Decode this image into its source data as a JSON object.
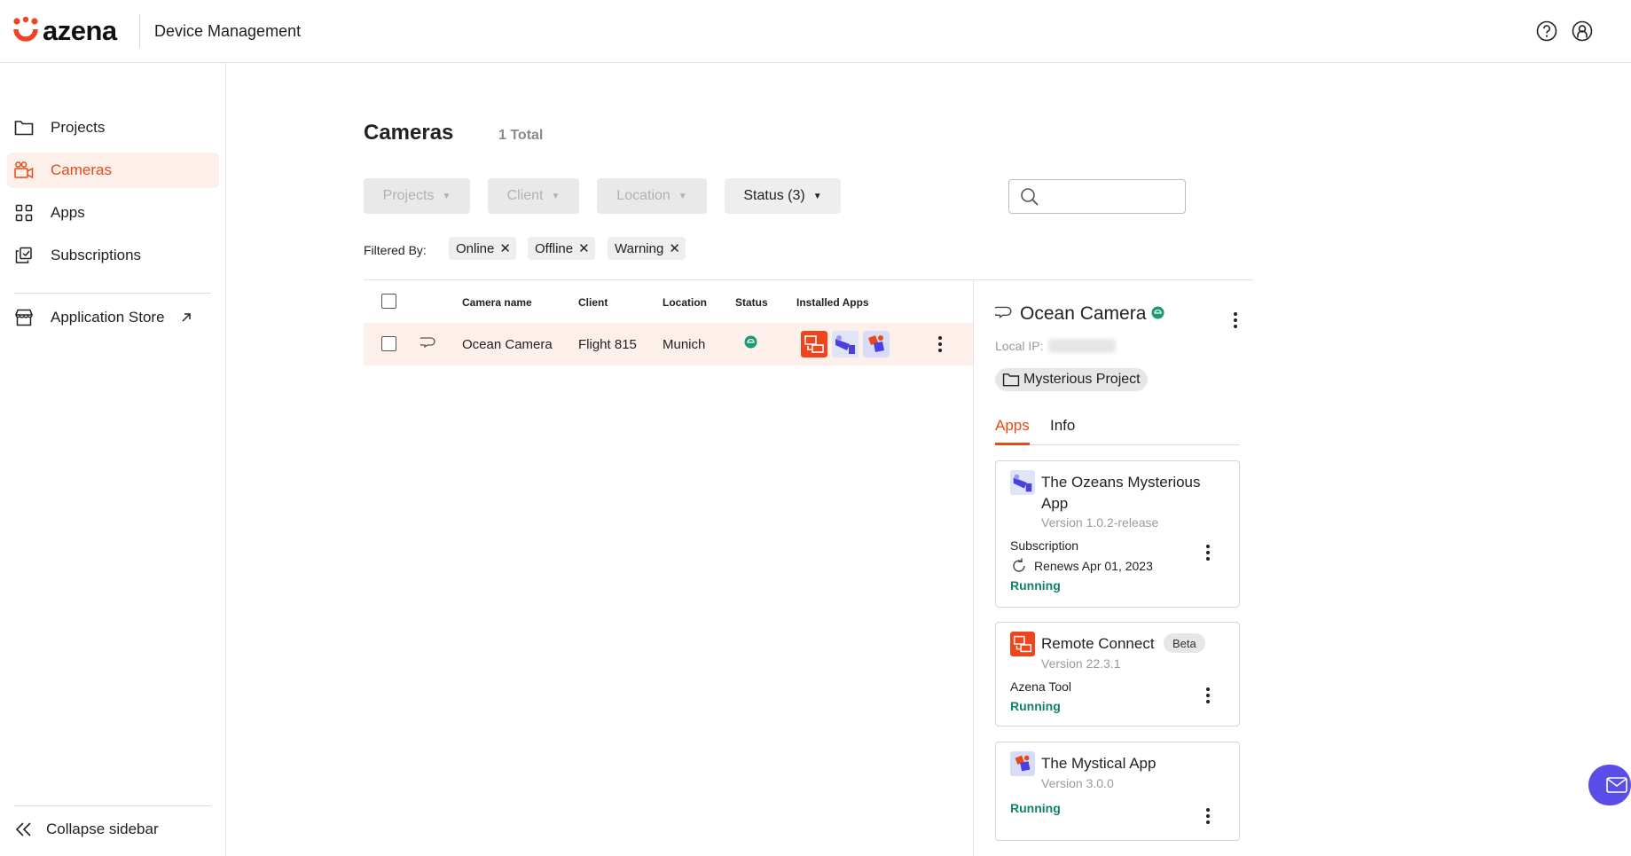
{
  "header": {
    "logo_text": "azena",
    "title": "Device Management",
    "help_icon": "help-icon",
    "account_icon": "user-icon",
    "brand_color": "#ef4423"
  },
  "sidebar": {
    "items": [
      {
        "label": "Projects",
        "icon": "folder-icon"
      },
      {
        "label": "Cameras",
        "icon": "camera-icon",
        "active": true
      },
      {
        "label": "Apps",
        "icon": "apps-grid-icon"
      },
      {
        "label": "Subscriptions",
        "icon": "subscriptions-icon"
      }
    ],
    "store": {
      "label": "Application Store",
      "icon": "store-icon",
      "external_icon": "arrow-up-right-icon"
    },
    "collapse_label": "Collapse sidebar"
  },
  "main": {
    "title": "Cameras",
    "total": "1 Total",
    "filters": {
      "projects": "Projects",
      "client": "Client",
      "location": "Location",
      "status": "Status (3)"
    },
    "search": {
      "placeholder": "",
      "value": ""
    },
    "filtered_by_label": "Filtered By:",
    "chips": [
      "Online",
      "Offline",
      "Warning"
    ],
    "table": {
      "columns": [
        "Camera name",
        "Client",
        "Location",
        "Status",
        "Installed Apps"
      ],
      "rows": [
        {
          "name": "Ocean Camera",
          "client": "Flight 815",
          "location": "Munich",
          "status": "online",
          "apps": [
            "remote-connect-icon",
            "ozeans-app-icon",
            "mystical-app-icon"
          ]
        }
      ]
    }
  },
  "detail": {
    "camera_name": "Ocean Camera",
    "status": "online",
    "local_ip_label": "Local IP:",
    "project": "Mysterious Project",
    "tabs": [
      "Apps",
      "Info"
    ],
    "active_tab": "Apps",
    "apps": [
      {
        "name_line1": "The Ozeans Mysterious",
        "name_line2": "App",
        "version": "Version 1.0.2-release",
        "label": "Subscription",
        "renews": "Renews Apr 01, 2023",
        "state": "Running",
        "icon": "ozeans-app-icon"
      },
      {
        "name": "Remote Connect",
        "badge": "Beta",
        "version": "Version 22.3.1",
        "label": "Azena Tool",
        "state": "Running",
        "icon": "remote-connect-icon"
      },
      {
        "name": "The Mystical App",
        "version": "Version 3.0.0",
        "state": "Running",
        "icon": "mystical-app-icon"
      }
    ]
  },
  "colors": {
    "accent": "#e64a19",
    "active_bg": "#fdefe9",
    "running": "#11826b",
    "online": "#1b9a74",
    "fab": "#5b4ee8"
  }
}
